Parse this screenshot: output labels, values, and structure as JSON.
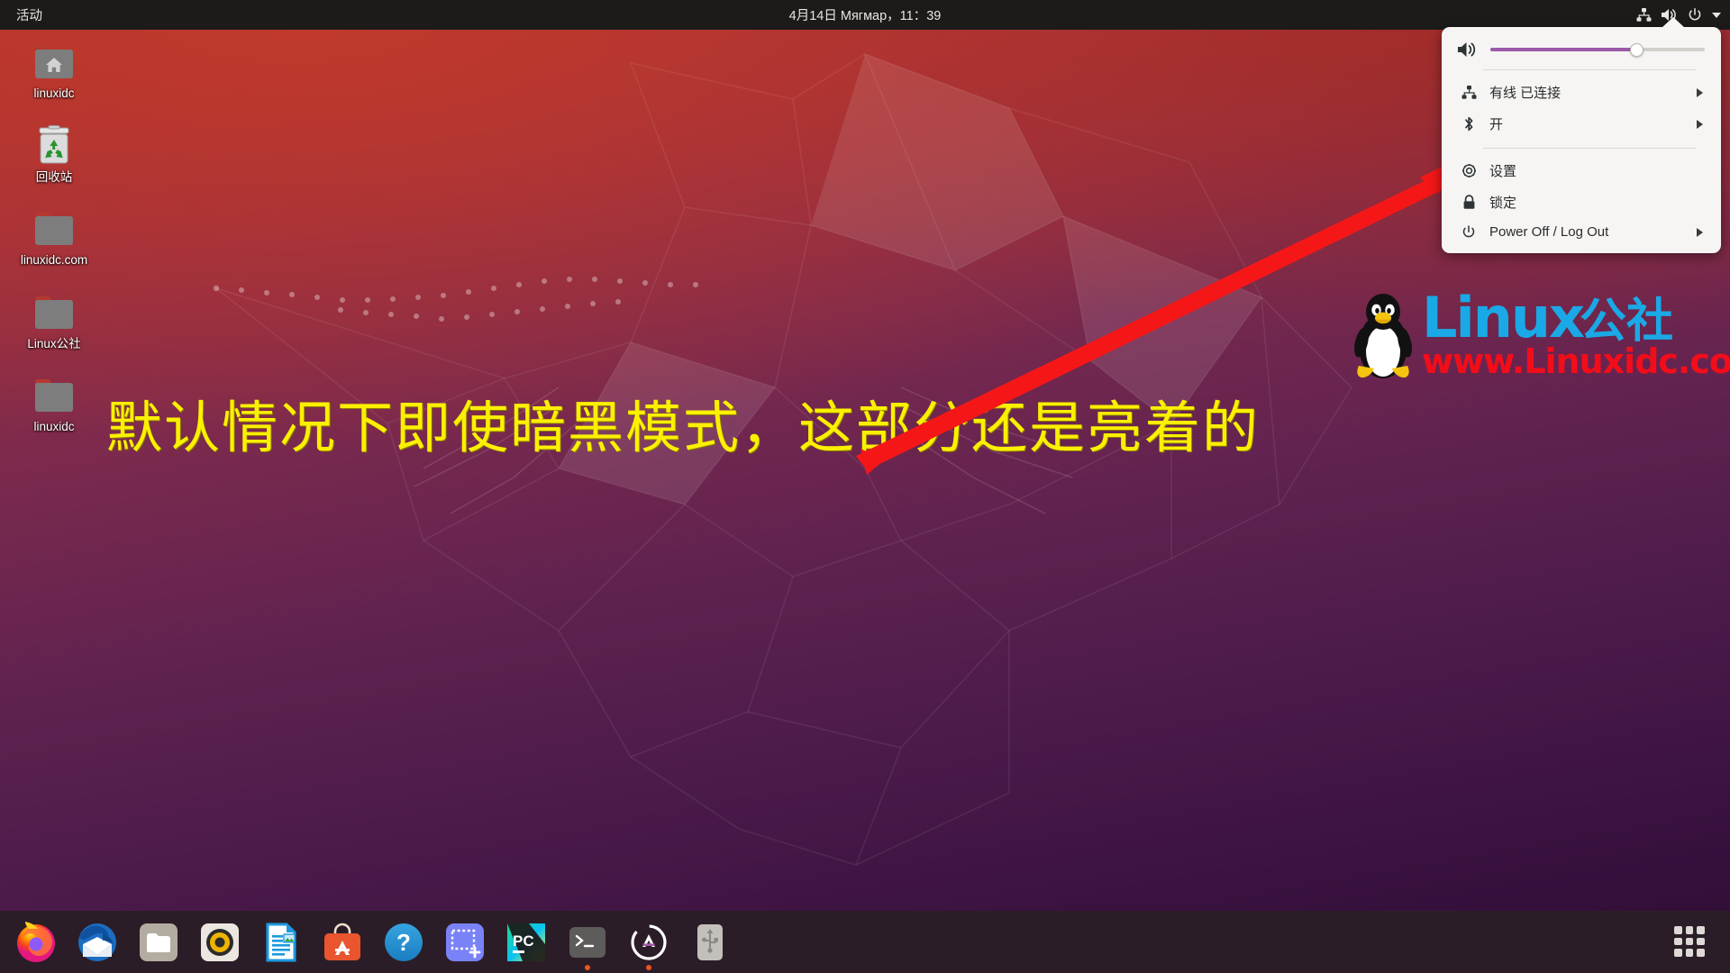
{
  "topbar": {
    "activities": "活动",
    "clock": "4月14日 Мягмар，11：39",
    "indicators": [
      {
        "name": "network-wired-icon",
        "label": "有线网络"
      },
      {
        "name": "volume-icon",
        "label": "音量"
      },
      {
        "name": "power-icon",
        "label": "电源"
      },
      {
        "name": "chevron-down-icon",
        "label": "展开"
      }
    ]
  },
  "desktop_icons": [
    {
      "label": "linuxidc",
      "type": "home-folder"
    },
    {
      "label": "回收站",
      "type": "trash"
    },
    {
      "label": "linuxidc.com",
      "type": "folder"
    },
    {
      "label": "Linux公社",
      "type": "folder"
    },
    {
      "label": "linuxidc",
      "type": "folder"
    }
  ],
  "annotation": {
    "text": "默认情况下即使暗黑模式，这部分还是亮着的",
    "color": "#fbf000",
    "arrow_color": "#f51717"
  },
  "logo": {
    "brand": "Linux",
    "brand_cn": "公社",
    "url": "www.Linuxidc.com",
    "brand_color": "#1aa9e6",
    "url_color": "#f20d1a"
  },
  "system_menu": {
    "volume": {
      "icon": "volume-high-icon",
      "level": 68,
      "fill_color": "#9b59a8"
    },
    "items": [
      {
        "icon": "network-wired-icon",
        "label": "有线 已连接",
        "has_submenu": true
      },
      {
        "icon": "bluetooth-icon",
        "label": "开",
        "has_submenu": true
      },
      {
        "icon": "settings-gear-icon",
        "label": "设置",
        "has_submenu": false
      },
      {
        "icon": "lock-icon",
        "label": "锁定",
        "has_submenu": false
      },
      {
        "icon": "power-icon",
        "label": "Power Off / Log Out",
        "has_submenu": true
      }
    ]
  },
  "dock": {
    "apps": [
      {
        "name": "firefox",
        "label": "Firefox",
        "running": false
      },
      {
        "name": "thunderbird",
        "label": "Thunderbird Mail",
        "running": false
      },
      {
        "name": "files",
        "label": "Files",
        "running": false
      },
      {
        "name": "rhythmbox",
        "label": "Rhythmbox",
        "running": false
      },
      {
        "name": "libreoffice-writer",
        "label": "LibreOffice Writer",
        "running": false
      },
      {
        "name": "ubuntu-software",
        "label": "Ubuntu Software",
        "running": false
      },
      {
        "name": "help",
        "label": "Help",
        "running": false
      },
      {
        "name": "screenshot",
        "label": "Screenshot",
        "running": false
      },
      {
        "name": "pycharm",
        "label": "PyCharm",
        "running": false
      },
      {
        "name": "terminal",
        "label": "Terminal",
        "running": true
      },
      {
        "name": "software-updater",
        "label": "Software Updater",
        "running": true
      },
      {
        "name": "usb-drive",
        "label": "USB Drive",
        "running": false
      }
    ],
    "apps_button": "show-applications"
  }
}
